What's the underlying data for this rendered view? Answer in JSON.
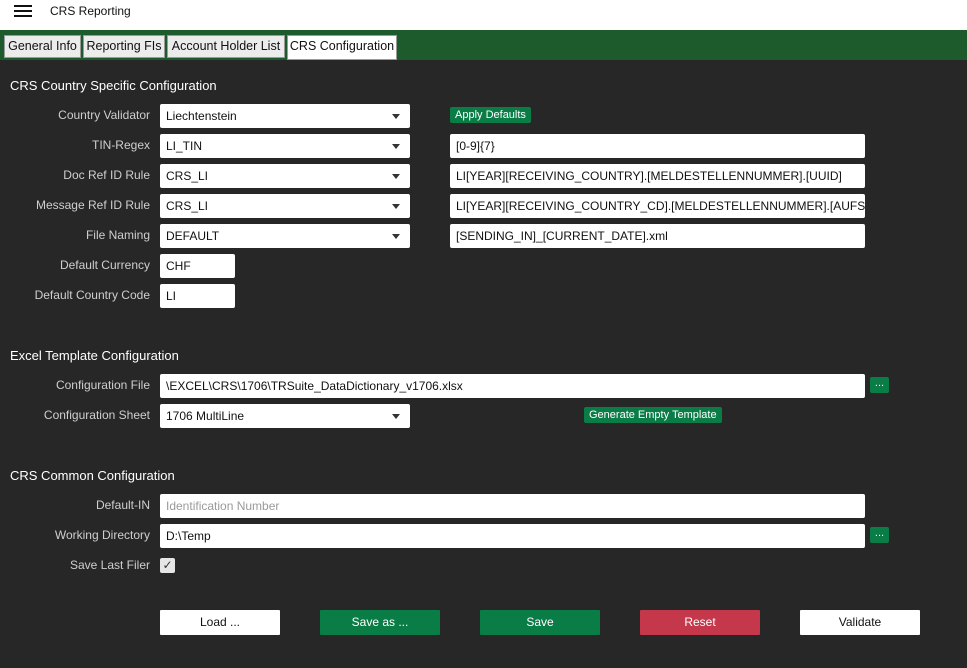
{
  "app": {
    "title": "CRS Reporting"
  },
  "tabs": [
    {
      "label": "General Info"
    },
    {
      "label": "Reporting FIs"
    },
    {
      "label": "Account Holder List"
    },
    {
      "label": "CRS Configuration"
    }
  ],
  "country_config": {
    "title": "CRS Country Specific Configuration",
    "country_validator": {
      "label": "Country Validator",
      "value": "Liechtenstein"
    },
    "apply_defaults_label": "Apply Defaults",
    "tin_regex": {
      "label": "TIN-Regex",
      "value": "LI_TIN",
      "pattern": "[0-9]{7}"
    },
    "doc_ref_id_rule": {
      "label": "Doc Ref ID Rule",
      "value": "CRS_LI",
      "pattern": "LI[YEAR][RECEIVING_COUNTRY].[MELDESTELLENNUMMER].[UUID]"
    },
    "message_ref_id_rule": {
      "label": "Message Ref ID Rule",
      "value": "CRS_LI",
      "pattern": "LI[YEAR][RECEIVING_COUNTRY_CD].[MELDESTELLENNUMMER].[AUFSTEI"
    },
    "file_naming": {
      "label": "File Naming",
      "value": "DEFAULT",
      "pattern": "[SENDING_IN]_[CURRENT_DATE].xml"
    },
    "default_currency": {
      "label": "Default Currency",
      "value": "CHF"
    },
    "default_country_code": {
      "label": "Default Country Code",
      "value": "LI"
    }
  },
  "excel_config": {
    "title": "Excel Template Configuration",
    "configuration_file": {
      "label": "Configuration File",
      "value": "\\EXCEL\\CRS\\1706\\TRSuite_DataDictionary_v1706.xlsx"
    },
    "browse_label": "...",
    "configuration_sheet": {
      "label": "Configuration Sheet",
      "value": "1706 MultiLine"
    },
    "generate_template_label": "Generate Empty Template"
  },
  "common_config": {
    "title": "CRS Common Configuration",
    "default_in": {
      "label": "Default-IN",
      "placeholder": "Identification Number"
    },
    "working_directory": {
      "label": "Working Directory",
      "value": "D:\\Temp"
    },
    "browse_label": "...",
    "save_last_filer": {
      "label": "Save Last Filer",
      "checked": true,
      "check_glyph": "✓"
    }
  },
  "actions": {
    "load": "Load ...",
    "save_as": "Save as ...",
    "save": "Save",
    "reset": "Reset",
    "validate": "Validate"
  },
  "colors": {
    "tabbar": "#1d5a2c",
    "accent_green": "#0a7c46",
    "reset_red": "#c5374a",
    "background": "#272727"
  }
}
